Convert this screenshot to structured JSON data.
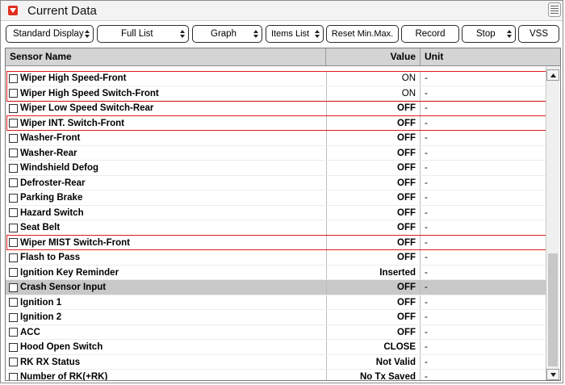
{
  "panel": {
    "title": "Current Data"
  },
  "toolbar": {
    "standard_display": "Standard Display",
    "full_list": "Full List",
    "graph": "Graph",
    "items_list": "Items List",
    "reset_min_max": "Reset Min.Max.",
    "record": "Record",
    "stop": "Stop",
    "vss": "VSS"
  },
  "table": {
    "headers": {
      "name": "Sensor Name",
      "value": "Value",
      "unit": "Unit"
    },
    "rows": [
      {
        "name": "Wiper High Speed-Front",
        "value": "ON",
        "unit": "-"
      },
      {
        "name": "Wiper High Speed Switch-Front",
        "value": "ON",
        "unit": "-"
      },
      {
        "name": "Wiper Low Speed Switch-Rear",
        "value": "OFF",
        "unit": "-"
      },
      {
        "name": "Wiper INT. Switch-Front",
        "value": "OFF",
        "unit": "-"
      },
      {
        "name": "Washer-Front",
        "value": "OFF",
        "unit": "-"
      },
      {
        "name": "Washer-Rear",
        "value": "OFF",
        "unit": "-"
      },
      {
        "name": "Windshield Defog",
        "value": "OFF",
        "unit": "-"
      },
      {
        "name": "Defroster-Rear",
        "value": "OFF",
        "unit": "-"
      },
      {
        "name": "Parking Brake",
        "value": "OFF",
        "unit": "-"
      },
      {
        "name": "Hazard Switch",
        "value": "OFF",
        "unit": "-"
      },
      {
        "name": "Seat Belt",
        "value": "OFF",
        "unit": "-"
      },
      {
        "name": "Wiper MIST Switch-Front",
        "value": "OFF",
        "unit": "-"
      },
      {
        "name": "Flash to Pass",
        "value": "OFF",
        "unit": "-"
      },
      {
        "name": "Ignition Key Reminder",
        "value": "Inserted",
        "unit": "-"
      },
      {
        "name": "Crash Sensor Input",
        "value": "OFF",
        "unit": "-"
      },
      {
        "name": "Ignition 1",
        "value": "OFF",
        "unit": "-"
      },
      {
        "name": "Ignition 2",
        "value": "OFF",
        "unit": "-"
      },
      {
        "name": "ACC",
        "value": "OFF",
        "unit": "-"
      },
      {
        "name": "Hood Open Switch",
        "value": "CLOSE",
        "unit": "-"
      },
      {
        "name": "RK RX Status",
        "value": "Not Valid",
        "unit": "-"
      },
      {
        "name": "Number of RK(+RK)",
        "value": "No Tx Saved",
        "unit": "-"
      }
    ]
  },
  "highlight": {
    "selected_row": "Crash Sensor Input",
    "marker_color": "#e31a1a"
  },
  "scrollbar": {
    "position_fraction": 0.6
  }
}
